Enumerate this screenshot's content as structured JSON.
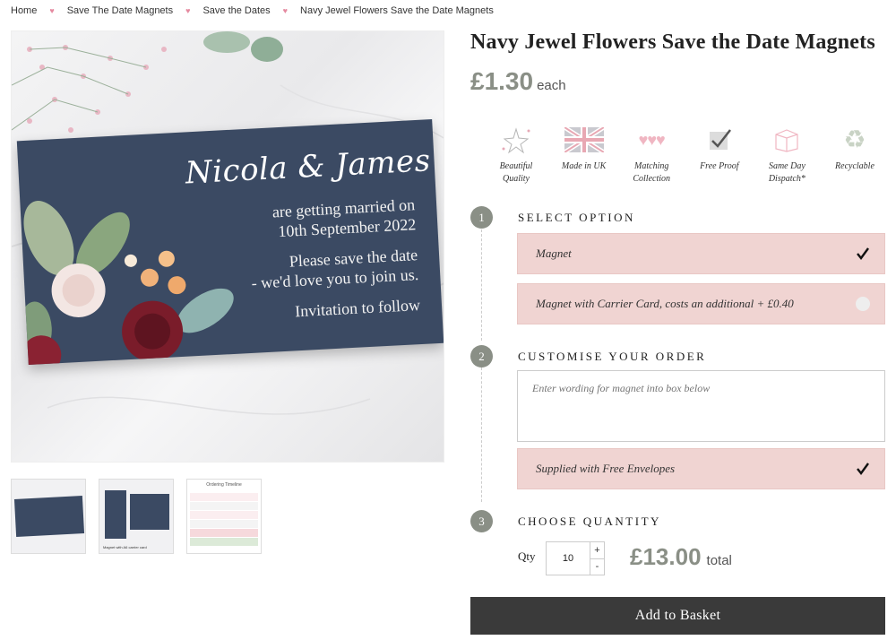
{
  "breadcrumb": {
    "items": [
      "Home",
      "Save The Date Magnets",
      "Save the Dates",
      "Navy Jewel Flowers Save the Date Magnets"
    ]
  },
  "product": {
    "title": "Navy Jewel Flowers Save the Date Magnets",
    "price": "£1.30",
    "price_suffix": "each"
  },
  "card_preview": {
    "names": "Nicola & James",
    "line1": "are getting married on",
    "line2": "10th September 2022",
    "line3": "Please save the date",
    "line4": "- we'd love you to join us.",
    "line5": "Invitation to follow"
  },
  "thumbnails": {
    "thumb2_caption": "Magnet with A6 carrier card",
    "thumb3_title": "Ordering Timeline"
  },
  "features": [
    {
      "label": "Beautiful Quality",
      "icon": "sparkle-star-icon"
    },
    {
      "label": "Made in UK",
      "icon": "union-flag-icon"
    },
    {
      "label": "Matching Collection",
      "icon": "hearts-icon"
    },
    {
      "label": "Free Proof",
      "icon": "checkmark-icon"
    },
    {
      "label": "Same Day Dispatch*",
      "icon": "box-icon"
    },
    {
      "label": "Recyclable",
      "icon": "recycle-icon"
    }
  ],
  "steps": {
    "one": {
      "number": "1",
      "title": "SELECT OPTION"
    },
    "two": {
      "number": "2",
      "title": "CUSTOMISE YOUR ORDER"
    },
    "three": {
      "number": "3",
      "title": "CHOOSE QUANTITY"
    }
  },
  "options": [
    {
      "label": "Magnet",
      "selected": true
    },
    {
      "label": "Magnet with Carrier Card, costs an additional + £0.40",
      "selected": false
    }
  ],
  "customise": {
    "placeholder": "Enter wording for magnet into box below",
    "envelopes_label": "Supplied with Free Envelopes",
    "envelopes_checked": true
  },
  "quantity": {
    "label": "Qty",
    "value": "10",
    "plus": "+",
    "minus": "-",
    "total": "£13.00",
    "total_suffix": "total"
  },
  "actions": {
    "add_to_basket": "Add to Basket"
  },
  "colors": {
    "accent_pink": "#f0d4d2",
    "step_grey": "#8a8f86",
    "card_navy": "#3b4a63",
    "button_dark": "#3a3a3a"
  }
}
